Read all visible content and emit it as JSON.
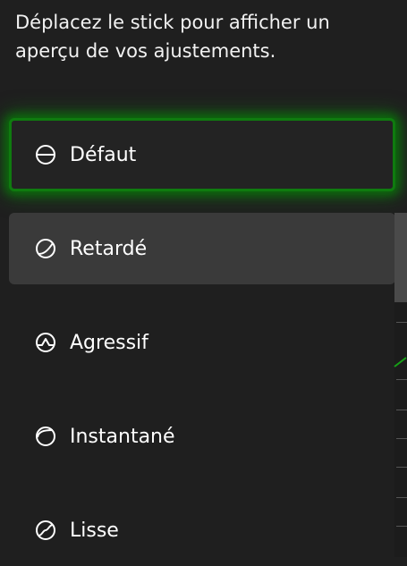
{
  "instructions": "Déplacez le stick pour afficher un aperçu de vos ajustements.",
  "options": [
    {
      "label": "Défaut",
      "icon": "default-curve-icon"
    },
    {
      "label": "Retardé",
      "icon": "delayed-curve-icon"
    },
    {
      "label": "Agressif",
      "icon": "aggressive-curve-icon"
    },
    {
      "label": "Instantané",
      "icon": "instant-curve-icon"
    },
    {
      "label": "Lisse",
      "icon": "smooth-curve-icon"
    }
  ],
  "selected_index": 0,
  "colors": {
    "accent": "#107c10",
    "background": "#1f1f1f",
    "hover": "#3a3a3a"
  }
}
